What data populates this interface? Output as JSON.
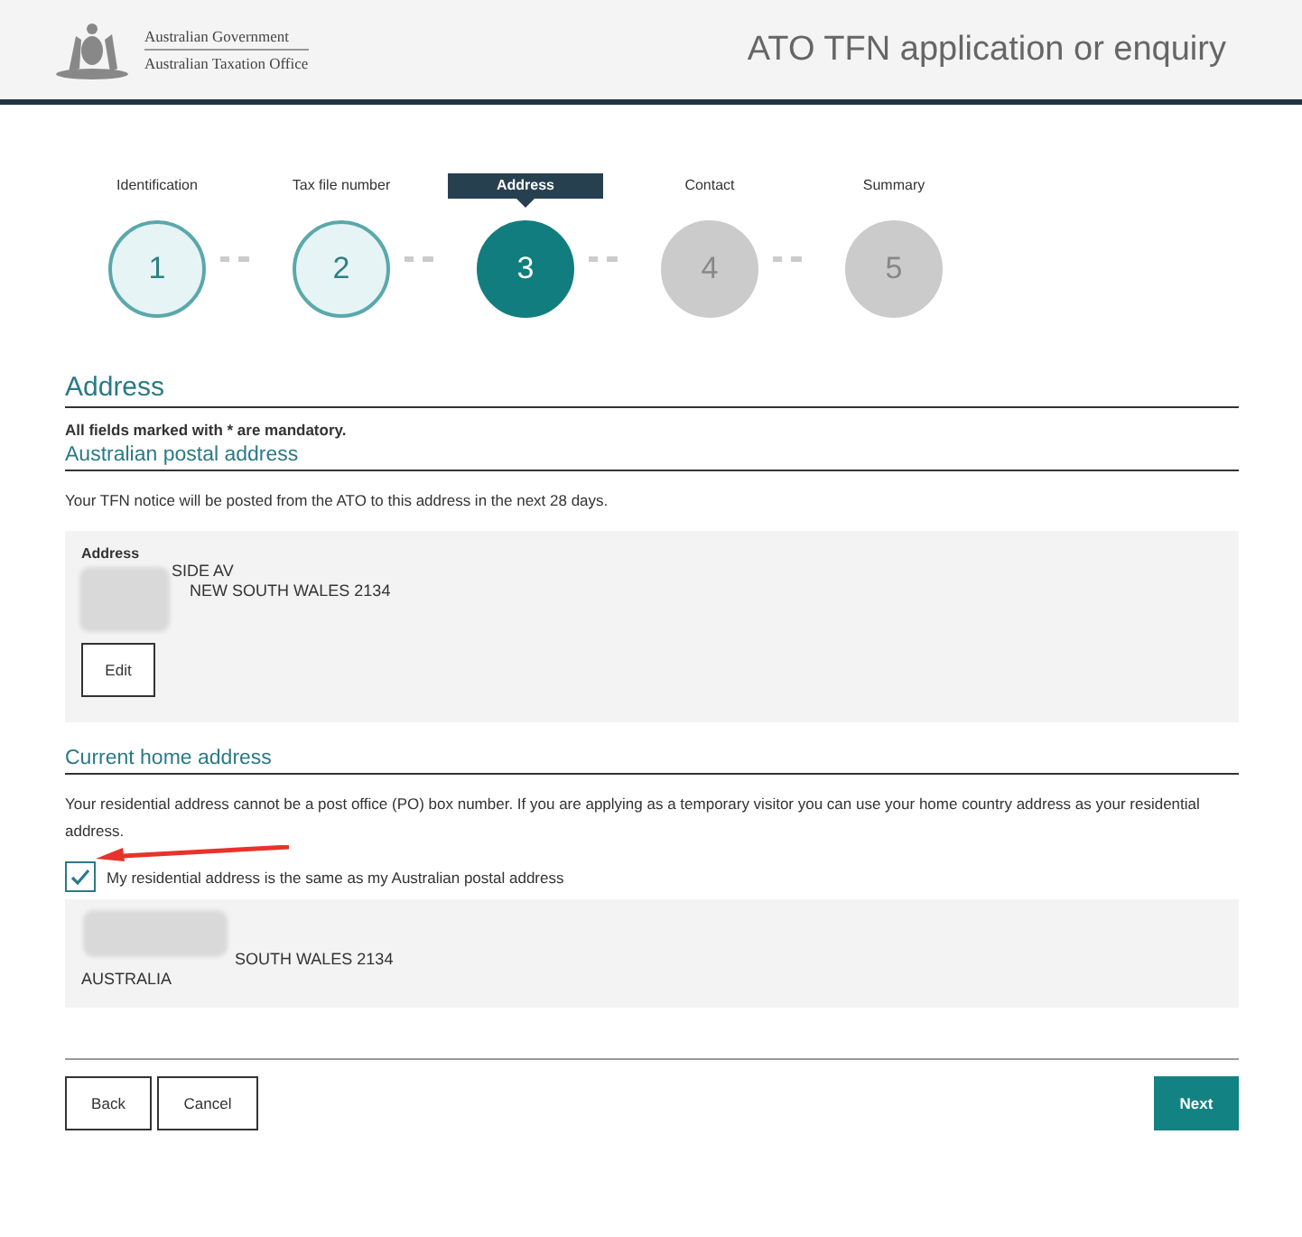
{
  "header": {
    "logo_lines": [
      "Australian Government",
      "Australian Taxation Office"
    ],
    "title": "ATO TFN application or enquiry"
  },
  "steps": [
    {
      "label": "Identification",
      "number": "1",
      "completed": true,
      "selected": false
    },
    {
      "label": "Tax file number",
      "number": "2",
      "completed": true,
      "selected": false
    },
    {
      "label": "Address",
      "number": "3",
      "completed": false,
      "selected": true
    },
    {
      "label": "Contact",
      "number": "4",
      "completed": false,
      "selected": false
    },
    {
      "label": "Summary",
      "number": "5",
      "completed": false,
      "selected": false
    }
  ],
  "page_heading": "Address",
  "mandatory_note": "All fields marked with * are mandatory.",
  "postal": {
    "heading": "Australian postal address",
    "note": "Your TFN notice will be posted from the ATO to this address in the next 28 days.",
    "label": "Address",
    "lines": [
      "SIDE AV",
      "NEW SOUTH WALES 2134"
    ],
    "edit_button": "Edit"
  },
  "home": {
    "heading": "Current home address",
    "note": "Your residential address cannot be a post office (PO) box number. If you are applying as a temporary visitor you can use your home country address as your residential address.",
    "same_checkbox": {
      "label": "My residential address is the same as my Australian postal address",
      "checked": true
    },
    "lines": [
      "SOUTH WALES 2134",
      "AUSTRALIA"
    ]
  },
  "buttons": {
    "back": "Back",
    "cancel": "Cancel",
    "next": "Next"
  }
}
